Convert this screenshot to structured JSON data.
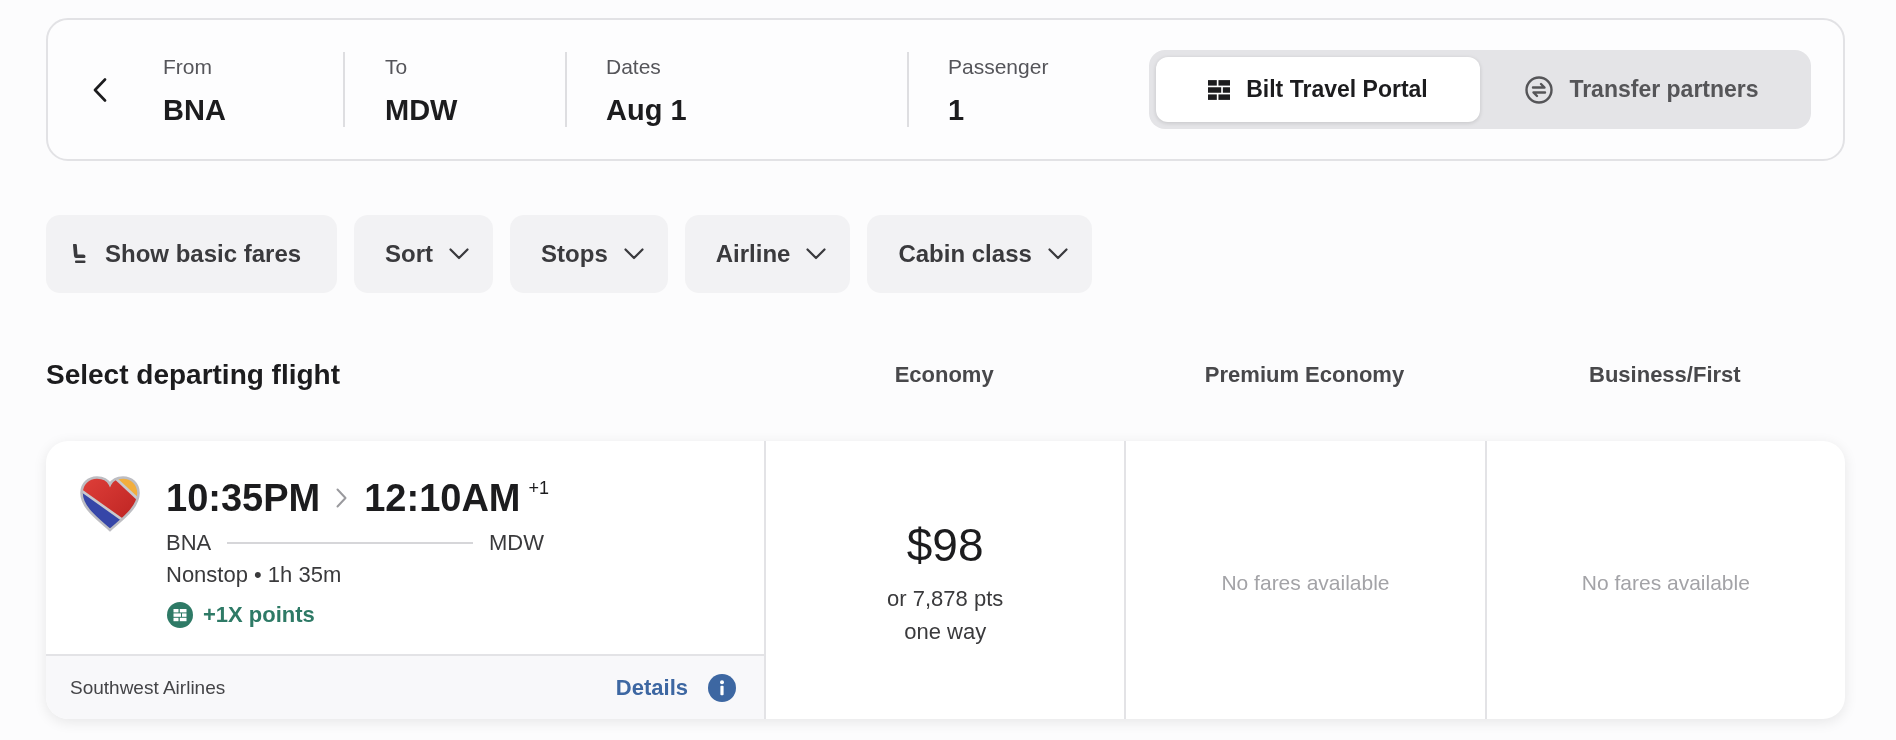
{
  "search": {
    "fields": [
      {
        "label": "From",
        "value": "BNA"
      },
      {
        "label": "To",
        "value": "MDW"
      },
      {
        "label": "Dates",
        "value": "Aug 1"
      },
      {
        "label": "Passenger",
        "value": "1"
      }
    ],
    "booking_modes": [
      {
        "label": "Bilt Travel Portal",
        "kind": "portal",
        "selected": true
      },
      {
        "label": "Transfer partners",
        "kind": "transfer",
        "selected": false
      }
    ]
  },
  "filters": [
    {
      "label": "Show basic fares",
      "kind": "toggle"
    },
    {
      "label": "Sort",
      "kind": "dropdown"
    },
    {
      "label": "Stops",
      "kind": "dropdown"
    },
    {
      "label": "Airline",
      "kind": "dropdown"
    },
    {
      "label": "Cabin class",
      "kind": "dropdown"
    }
  ],
  "results": {
    "title": "Select departing flight",
    "columns": [
      "Economy",
      "Premium Economy",
      "Business/First"
    ],
    "flights": [
      {
        "depart": "10:35PM",
        "arrive": "12:10AM",
        "day_offset": "+1",
        "origin": "BNA",
        "destination": "MDW",
        "summary": "Nonstop • 1h 35m",
        "points_bonus": "+1X points",
        "airline": "Southwest Airlines",
        "details": "Details",
        "fares": [
          {
            "kind": "price",
            "price": "$98",
            "points": "or 7,878 pts",
            "note": "one way"
          },
          {
            "kind": "unavailable",
            "text": "No fares available"
          },
          {
            "kind": "unavailable",
            "text": "No fares available"
          }
        ]
      }
    ]
  }
}
